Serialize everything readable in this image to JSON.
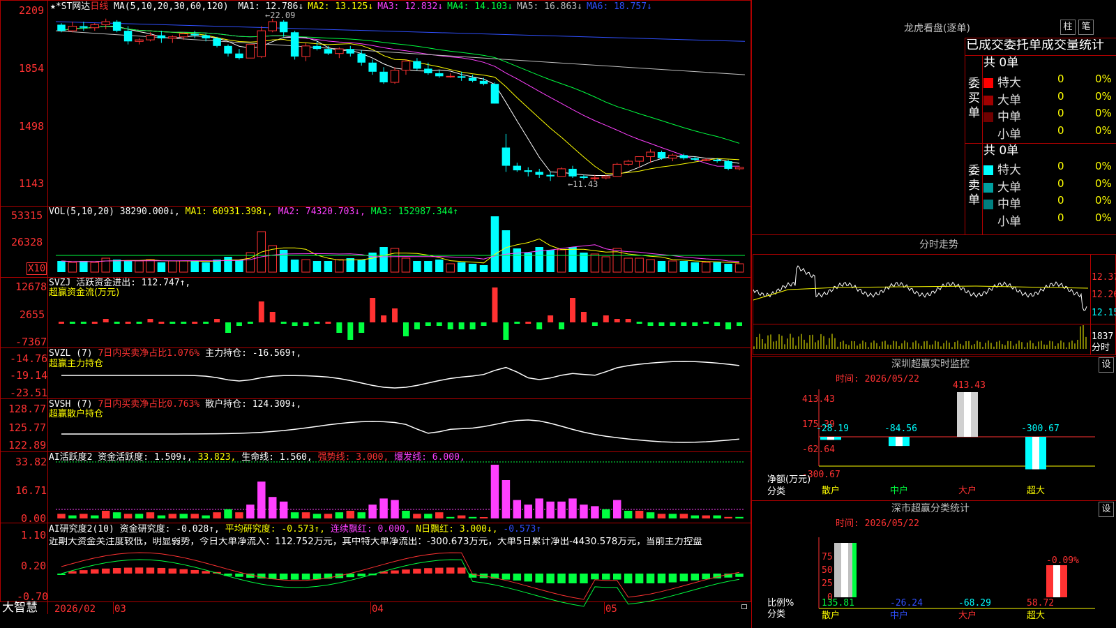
{
  "header": {
    "stock_prefix": "★*ST网达",
    "period": "日线",
    "ma_spec": "MA(5,10,20,30,60,120)",
    "ma_values": [
      {
        "label": "MA1:",
        "value": "12.786↓",
        "color": "#ffffff"
      },
      {
        "label": "MA2:",
        "value": "13.125↓",
        "color": "#ffff00"
      },
      {
        "label": "MA3:",
        "value": "12.832↓",
        "color": "#ff40ff"
      },
      {
        "label": "MA4:",
        "value": "14.103↓",
        "color": "#00ff40"
      },
      {
        "label": "MA5:",
        "value": "16.863↓",
        "color": "#c0c0c0"
      },
      {
        "label": "MA6:",
        "value": "18.757↓",
        "color": "#3050ff"
      }
    ]
  },
  "price_axis": [
    "2209",
    "1854",
    "1498",
    "1143"
  ],
  "annotations": {
    "high": "←22.09",
    "low": "←11.43"
  },
  "vol_panel": {
    "title": "VOL(5,10,20)",
    "value": "38290.000↓,",
    "ma1": "MA1: 60931.398↓,",
    "ma2": "MA2: 74320.703↓,",
    "ma3": "MA3: 152987.344↑",
    "axis": [
      "53315",
      "26328"
    ],
    "unit": "X10"
  },
  "svzj_panel": {
    "title": "SVZJ  活跃资金进出: 112.747↑,",
    "subtitle": "超赢资金流(万元)",
    "axis": [
      "12678",
      "2655",
      "-7367"
    ]
  },
  "svzl_panel": {
    "title": "SVZL (7)",
    "red_text": "7日内买卖净占比1.076%",
    "value": "主力持仓: -16.569↑,",
    "subtitle": "超赢主力持仓",
    "axis": [
      "-14.76",
      "-19.14",
      "-23.51"
    ]
  },
  "svsh_panel": {
    "title": "SVSH (7)",
    "red_text": "7日内买卖净占比0.763%",
    "value": "散户持仓: 124.309↓,",
    "subtitle": "超赢散户持仓",
    "axis": [
      "128.77",
      "125.77",
      "122.89"
    ]
  },
  "ai2_panel": {
    "title": "AI活跃度2 资金活跃度: 1.509↓,",
    "v2": "33.823,",
    "v3": "生命线: 1.560,",
    "v4": "强势线: 3.000,",
    "v5": "爆发线: 6.000,",
    "axis": [
      "33.82",
      "16.71",
      "0.00"
    ]
  },
  "ai_research_panel": {
    "title": "AI研究度2(10) 资金研究度: -0.028↑,",
    "avg": "平均研究度: -0.573↑,",
    "cont": "连续飘红: 0.000,",
    "nday": "N日飘红: 3.000↓,",
    "last": "-0.573↑",
    "comment": "近期大资金关注度较低，明显弱势，今日大单净流入：112.752万元，其中特大单净流出：-300.673万元，大单5日累计净出-4430.578万元，当前主力控盘",
    "axis": [
      "1.10",
      "0.20",
      "-0.70"
    ]
  },
  "time_axis": {
    "brand": "大智慧",
    "labels": [
      "2026/02",
      "03",
      "04",
      "05"
    ]
  },
  "dragon_tiger": {
    "title": "龙虎看盘(逐单)",
    "btn_bar": "柱",
    "btn_count": "笔",
    "tabs_text": "已成交委托单成交量统计",
    "buy_label": "委买单",
    "sell_label": "委卖单",
    "buy_total": "共 0单",
    "sell_total": "共 0单",
    "buy_rows": [
      {
        "name": "特大",
        "count": "0",
        "pct": "0%",
        "color": "#ff0000"
      },
      {
        "name": "大单",
        "count": "0",
        "pct": "0%",
        "color": "#a00000"
      },
      {
        "name": "中单",
        "count": "0",
        "pct": "0%",
        "color": "#700000"
      },
      {
        "name": "小单",
        "count": "0",
        "pct": "0%",
        "color": "#000000"
      }
    ],
    "sell_rows": [
      {
        "name": "特大",
        "count": "0",
        "pct": "0%",
        "color": "#00ffff"
      },
      {
        "name": "大单",
        "count": "0",
        "pct": "0%",
        "color": "#00a0a0"
      },
      {
        "name": "中单",
        "count": "0",
        "pct": "0%",
        "color": "#008080"
      },
      {
        "name": "小单",
        "count": "0",
        "pct": "0%",
        "color": "#000000"
      }
    ]
  },
  "intraday": {
    "title": "分时走势",
    "axis": [
      "12.37",
      "12.26",
      "12.15"
    ],
    "vol_label": "1837",
    "vol_unit": "分时"
  },
  "sz_monitor": {
    "title": "深圳超赢实时监控",
    "btn": "设",
    "time": "时间: 2026/05/22",
    "axis": [
      "413.43",
      "175.39",
      "-62.64",
      "-300.67"
    ],
    "ylabel1": "净额(万元)",
    "ylabel2": "分类",
    "bar_labels": [
      "-28.19",
      "-84.56",
      "413.43",
      "-300.67"
    ],
    "categories": [
      "散户",
      "中户",
      "大户",
      "超大"
    ]
  },
  "sz_category": {
    "title": "深市超赢分类统计",
    "btn": "设",
    "time": "时间: 2026/05/22",
    "axis": [
      "75",
      "50",
      "25",
      "0"
    ],
    "ylabel1": "比例%",
    "ylabel2": "分类",
    "top_label": "-0.09%",
    "values": [
      "135.81",
      "-26.24",
      "-68.29",
      "58.72"
    ],
    "categories": [
      "散户",
      "中户",
      "大户",
      "超大"
    ]
  },
  "colors": {
    "border": "#b00000",
    "up": "#ff3232",
    "down": "#00ffff",
    "volume_up": "#ff3232",
    "volume_down": "#00ffff"
  },
  "chart_data": {
    "type": "candlestick",
    "ylim": [
      11.0,
      22.5
    ],
    "ohlc": [
      [
        21.7,
        21.8,
        21.2,
        21.3
      ],
      [
        21.3,
        21.9,
        21.2,
        21.6
      ],
      [
        21.6,
        21.9,
        21.3,
        21.5
      ],
      [
        21.5,
        21.8,
        21.3,
        21.7
      ],
      [
        21.7,
        22.1,
        21.4,
        21.9
      ],
      [
        21.9,
        22.0,
        21.2,
        21.3
      ],
      [
        21.3,
        21.6,
        20.4,
        20.6
      ],
      [
        20.6,
        20.8,
        20.4,
        20.7
      ],
      [
        20.7,
        21.2,
        20.6,
        21.0
      ],
      [
        21.0,
        21.3,
        20.5,
        20.8
      ],
      [
        20.8,
        21.0,
        20.5,
        20.9
      ],
      [
        20.9,
        21.2,
        20.7,
        21.1
      ],
      [
        21.1,
        21.3,
        20.8,
        21.0
      ],
      [
        21.0,
        21.1,
        20.6,
        20.8
      ],
      [
        20.8,
        20.9,
        20.2,
        20.3
      ],
      [
        20.3,
        20.4,
        19.6,
        19.8
      ],
      [
        19.8,
        20.1,
        19.4,
        19.5
      ],
      [
        19.5,
        20.4,
        19.5,
        20.4
      ],
      [
        19.6,
        21.6,
        19.5,
        21.3
      ],
      [
        21.3,
        22.09,
        21.2,
        21.9
      ],
      [
        21.9,
        22.0,
        20.9,
        21.2
      ],
      [
        21.2,
        21.3,
        19.4,
        19.6
      ],
      [
        19.6,
        20.5,
        19.3,
        20.3
      ],
      [
        20.3,
        20.6,
        20.0,
        20.1
      ],
      [
        20.1,
        20.3,
        19.7,
        19.8
      ],
      [
        19.8,
        20.2,
        19.5,
        20.1
      ],
      [
        20.1,
        20.3,
        19.6,
        19.8
      ],
      [
        19.8,
        20.0,
        19.0,
        19.2
      ],
      [
        19.2,
        19.4,
        18.4,
        18.6
      ],
      [
        18.6,
        18.9,
        17.8,
        17.9
      ],
      [
        17.9,
        18.9,
        17.8,
        18.7
      ],
      [
        18.7,
        19.4,
        18.4,
        19.3
      ],
      [
        19.3,
        19.5,
        18.7,
        18.8
      ],
      [
        18.8,
        19.2,
        18.4,
        18.5
      ],
      [
        18.5,
        18.7,
        18.2,
        18.3
      ],
      [
        18.3,
        18.5,
        18.2,
        18.3
      ],
      [
        18.3,
        18.6,
        18.0,
        18.2
      ],
      [
        18.2,
        18.4,
        17.9,
        18.0
      ],
      [
        18.0,
        18.2,
        17.7,
        17.8
      ],
      [
        17.8,
        17.9,
        16.5,
        16.5
      ],
      [
        13.6,
        14.5,
        12.0,
        12.4
      ],
      [
        12.4,
        12.6,
        12.0,
        12.1
      ],
      [
        12.1,
        12.3,
        11.7,
        12.0
      ],
      [
        12.0,
        12.2,
        11.6,
        11.8
      ],
      [
        11.8,
        12.0,
        11.4,
        11.7
      ],
      [
        11.7,
        12.3,
        11.7,
        12.2
      ],
      [
        12.2,
        12.4,
        11.6,
        11.7
      ],
      [
        11.7,
        11.8,
        11.5,
        11.6
      ],
      [
        11.6,
        11.8,
        11.4,
        11.6
      ],
      [
        11.6,
        11.8,
        11.5,
        11.7
      ],
      [
        11.7,
        12.6,
        11.7,
        12.5
      ],
      [
        12.5,
        12.8,
        12.4,
        12.7
      ],
      [
        12.7,
        13.0,
        12.3,
        13.0
      ],
      [
        13.0,
        13.5,
        12.6,
        13.3
      ],
      [
        13.3,
        13.4,
        12.8,
        12.9
      ],
      [
        12.9,
        13.2,
        12.7,
        13.1
      ],
      [
        13.1,
        13.2,
        12.8,
        12.9
      ],
      [
        12.9,
        13.0,
        12.7,
        12.8
      ],
      [
        12.8,
        12.9,
        12.7,
        12.8
      ],
      [
        12.8,
        12.9,
        12.6,
        12.7
      ],
      [
        12.7,
        12.8,
        12.1,
        12.2
      ],
      [
        12.2,
        12.4,
        12.1,
        12.3
      ]
    ],
    "volume": [
      8,
      7,
      8,
      7,
      10,
      9,
      8,
      8,
      9,
      7,
      8,
      8,
      8,
      7,
      9,
      11,
      9,
      14,
      29,
      19,
      16,
      9,
      9,
      8,
      8,
      9,
      10,
      9,
      14,
      18,
      17,
      10,
      8,
      8,
      9,
      6,
      7,
      6,
      5,
      40,
      30,
      17,
      14,
      18,
      16,
      16,
      18,
      14,
      13,
      11,
      17,
      10,
      10,
      9,
      8,
      8,
      8,
      7,
      7,
      7,
      6,
      6
    ],
    "svzj": [
      0,
      0,
      0,
      0,
      1,
      0,
      0,
      0,
      1,
      0,
      0,
      0,
      0,
      0,
      1,
      -3,
      -1,
      0,
      6,
      3,
      0,
      -1,
      -1,
      0,
      0,
      -3,
      -5,
      -3,
      7,
      2,
      4,
      -4,
      -2,
      -1,
      -1,
      -2,
      -2,
      -2,
      -1,
      10,
      -5,
      0,
      0,
      -2,
      2,
      -2,
      7,
      3,
      -1,
      2,
      1,
      1,
      0,
      -1,
      -1,
      -1,
      -1,
      -1,
      0,
      -1,
      -2,
      -1
    ]
  }
}
